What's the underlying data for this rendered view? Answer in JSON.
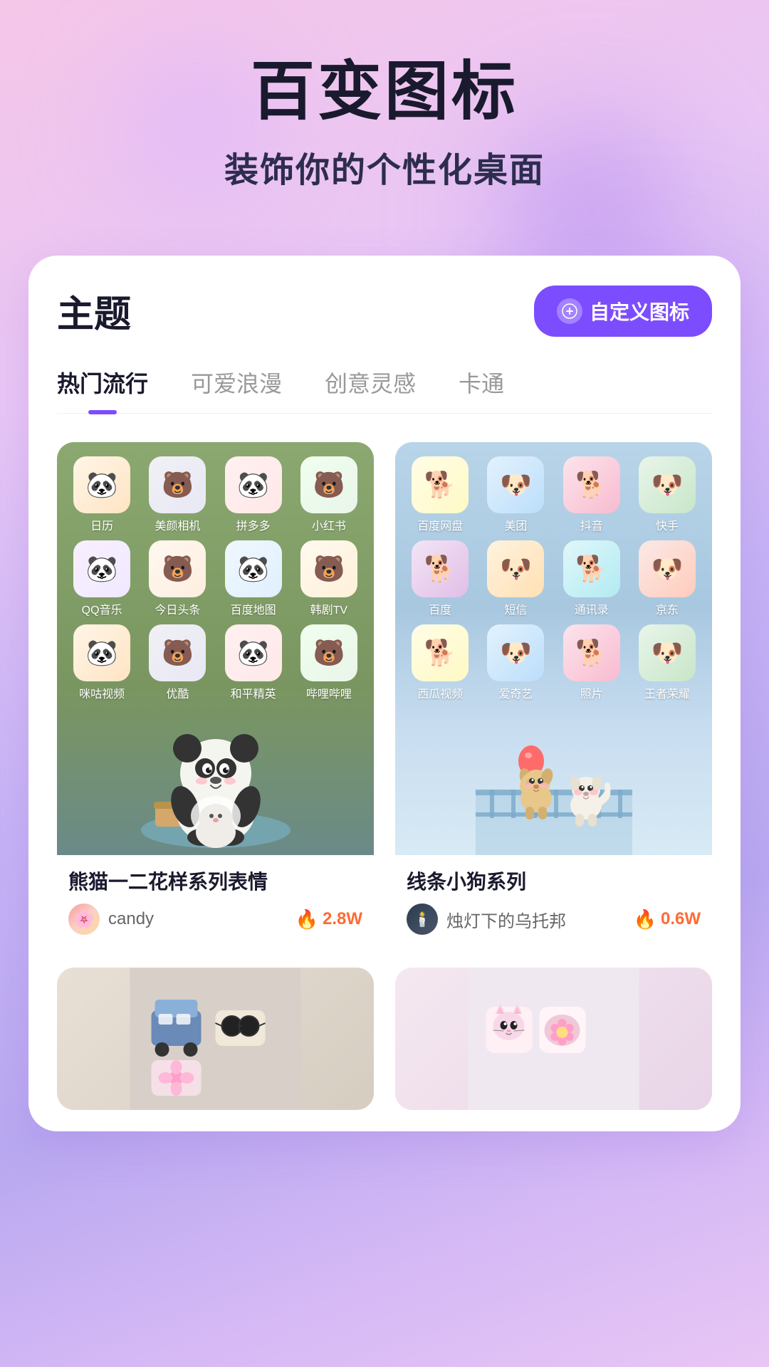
{
  "header": {
    "main_title": "百变图标",
    "sub_title": "装饰你的个性化桌面"
  },
  "card": {
    "title": "主题",
    "custom_btn_label": "自定义图标",
    "tabs": [
      {
        "label": "热门流行",
        "active": true
      },
      {
        "label": "可爱浪漫",
        "active": false
      },
      {
        "label": "创意灵感",
        "active": false
      },
      {
        "label": "卡通",
        "active": false
      }
    ]
  },
  "themes": [
    {
      "id": "panda",
      "name": "熊猫一二花样系列表情",
      "author": "candy",
      "hot_count": "2.8W",
      "apps": [
        {
          "label": "日历",
          "emoji": "🐼"
        },
        {
          "label": "美颜相机",
          "emoji": "🐻"
        },
        {
          "label": "拼多多",
          "emoji": "🐼"
        },
        {
          "label": "小红书",
          "emoji": "🐻"
        },
        {
          "label": "QQ音乐",
          "emoji": "🐼"
        },
        {
          "label": "今日头条",
          "emoji": "🐻"
        },
        {
          "label": "百度地图",
          "emoji": "🐼"
        },
        {
          "label": "韩剧TV",
          "emoji": "🐻"
        },
        {
          "label": "咪咕视频",
          "emoji": "🐼"
        },
        {
          "label": "优酷",
          "emoji": "🐻"
        },
        {
          "label": "和平精英",
          "emoji": "🐼"
        },
        {
          "label": "哔哩哔哩",
          "emoji": "🐻"
        }
      ]
    },
    {
      "id": "dog",
      "name": "线条小狗系列",
      "author": "烛灯下的乌托邦",
      "hot_count": "0.6W",
      "apps": [
        {
          "label": "百度网盘",
          "emoji": "🐕"
        },
        {
          "label": "美团",
          "emoji": "🐶"
        },
        {
          "label": "抖音",
          "emoji": "🐕"
        },
        {
          "label": "快手",
          "emoji": "🐶"
        },
        {
          "label": "百度",
          "emoji": "🐕"
        },
        {
          "label": "短信",
          "emoji": "🐶"
        },
        {
          "label": "通讯录",
          "emoji": "🐕"
        },
        {
          "label": "京东",
          "emoji": "🐶"
        },
        {
          "label": "西瓜视频",
          "emoji": "🐕"
        },
        {
          "label": "爱奇艺",
          "emoji": "🐶"
        },
        {
          "label": "照片",
          "emoji": "🐕"
        },
        {
          "label": "王者荣耀",
          "emoji": "🐶"
        }
      ]
    }
  ]
}
